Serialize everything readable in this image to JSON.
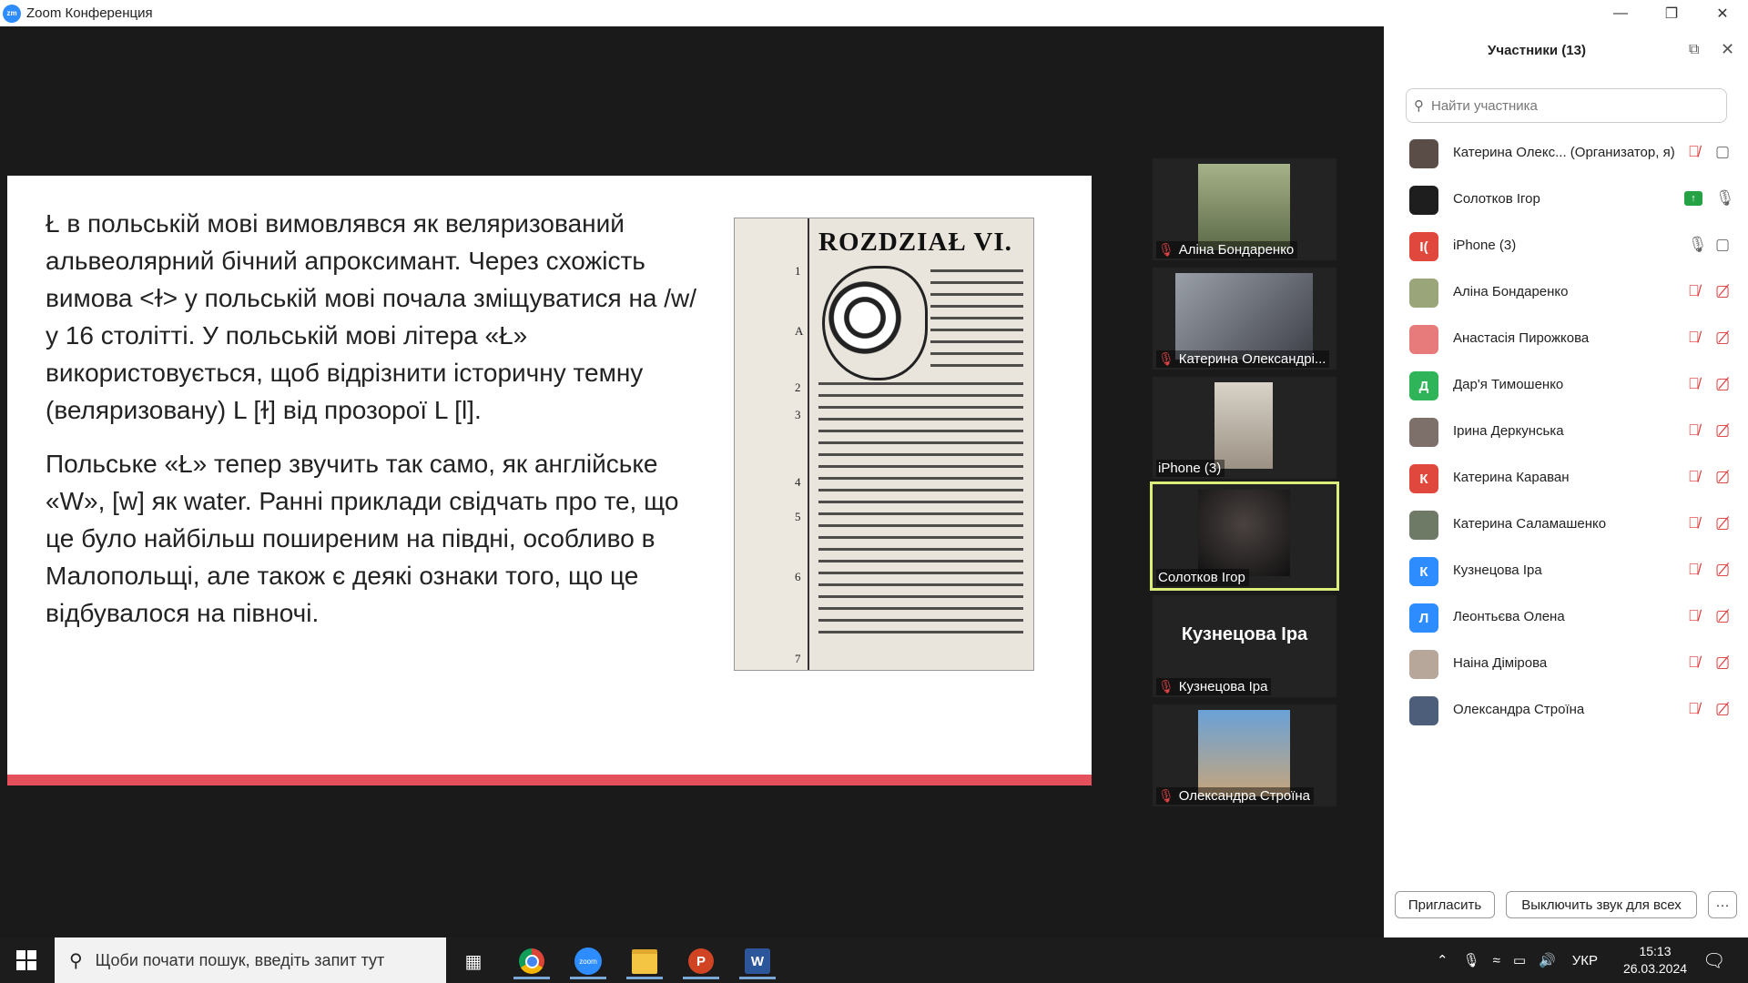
{
  "window": {
    "title": "Zoom Конференция"
  },
  "slide": {
    "paragraph1": "Ł в польській мові вимовлявся як веляризований альвеолярний бічний апроксимант. Через схожість вимова <ɫ> у польській мові почала зміщуватися на /w/ у 16 столітті. У польській мові літера «Ł» використовується, щоб відрізнити історичну темну (веляризовану) L [ɫ] від прозорої L [l].",
    "paragraph2": "Польське «Ł» тепер звучить так само, як англійське «W», [w] як water. Ранні приклади свідчать про те, що це було найбільш поширеним на півдні, особливо в Малопольщі, але також є деякі ознаки того, що це відбувалося на півночі.",
    "book_heading": "ROZDZIAŁ VI."
  },
  "video_tiles": [
    {
      "name": "Аліна Бондаренко",
      "muted": true,
      "photo_color": "#8a9a6a"
    },
    {
      "name": "Катерина Олександрі...",
      "muted": true,
      "photo_color": "#6c6f78"
    },
    {
      "name": "iPhone (3)",
      "muted": false,
      "photo_color": "#c9c2b5"
    },
    {
      "name": "Солотков Ігор",
      "muted": false,
      "active": true,
      "photo_color": "#2a2a2a"
    },
    {
      "name": "Кузнецова Іра",
      "muted": true,
      "big_label": "Кузнецова Іра"
    },
    {
      "name": "Олександра Строїна",
      "muted": true,
      "photo_color": "#4a7ab0"
    }
  ],
  "participants_panel": {
    "title": "Участники (13)",
    "search_placeholder": "Найти участника",
    "participants": [
      {
        "name": "Катерина Олекс... (Организатор, я)",
        "avatar": "",
        "avatar_color": "#5a4d48",
        "mic": "muted",
        "video": "on"
      },
      {
        "name": "Солотков Ігор",
        "avatar": "",
        "avatar_color": "#1e1e1e",
        "mic": "on",
        "sharing": true
      },
      {
        "name": "iPhone (3)",
        "avatar": "I(",
        "avatar_color": "#e0483d",
        "mic": "on",
        "video": "on"
      },
      {
        "name": "Аліна Бондаренко",
        "avatar": "",
        "avatar_color": "#9aa57a",
        "mic": "muted",
        "video": "off"
      },
      {
        "name": "Анастасія Пирожкова",
        "avatar": "",
        "avatar_color": "#e77a7a",
        "mic": "muted",
        "video": "off"
      },
      {
        "name": "Дар'я Тимошенко",
        "avatar": "Д",
        "avatar_color": "#2fb45a",
        "mic": "muted",
        "video": "off"
      },
      {
        "name": "Ірина Деркунська",
        "avatar": "",
        "avatar_color": "#7d6f6a",
        "mic": "muted",
        "video": "off"
      },
      {
        "name": "Катерина Караван",
        "avatar": "К",
        "avatar_color": "#e0483d",
        "mic": "muted",
        "video": "off"
      },
      {
        "name": "Катерина Саламашенко",
        "avatar": "",
        "avatar_color": "#6e7a66",
        "mic": "muted",
        "video": "off"
      },
      {
        "name": "Кузнецова Іра",
        "avatar": "К",
        "avatar_color": "#2d8cff",
        "mic": "muted",
        "video": "off"
      },
      {
        "name": "Леонтьєва Олена",
        "avatar": "Л",
        "avatar_color": "#2d8cff",
        "mic": "muted",
        "video": "off"
      },
      {
        "name": "Наіна Дімірова",
        "avatar": "",
        "avatar_color": "#b7a69a",
        "mic": "muted",
        "video": "off"
      },
      {
        "name": "Олександра Строїна",
        "avatar": "",
        "avatar_color": "#4c5e7a",
        "mic": "muted",
        "video": "off"
      }
    ],
    "invite_label": "Пригласить",
    "mute_all_label": "Выключить звук для всех",
    "more_label": "···"
  },
  "taskbar": {
    "search_placeholder": "Щоби почати пошук, введіть запит тут",
    "language": "УКР",
    "time": "15:13",
    "date": "26.03.2024"
  },
  "colors": {
    "accent": "#2D8CFF",
    "slide_bar": "#e4505b",
    "active_speaker": "#dcee7a",
    "muted_red": "#dd3333"
  }
}
